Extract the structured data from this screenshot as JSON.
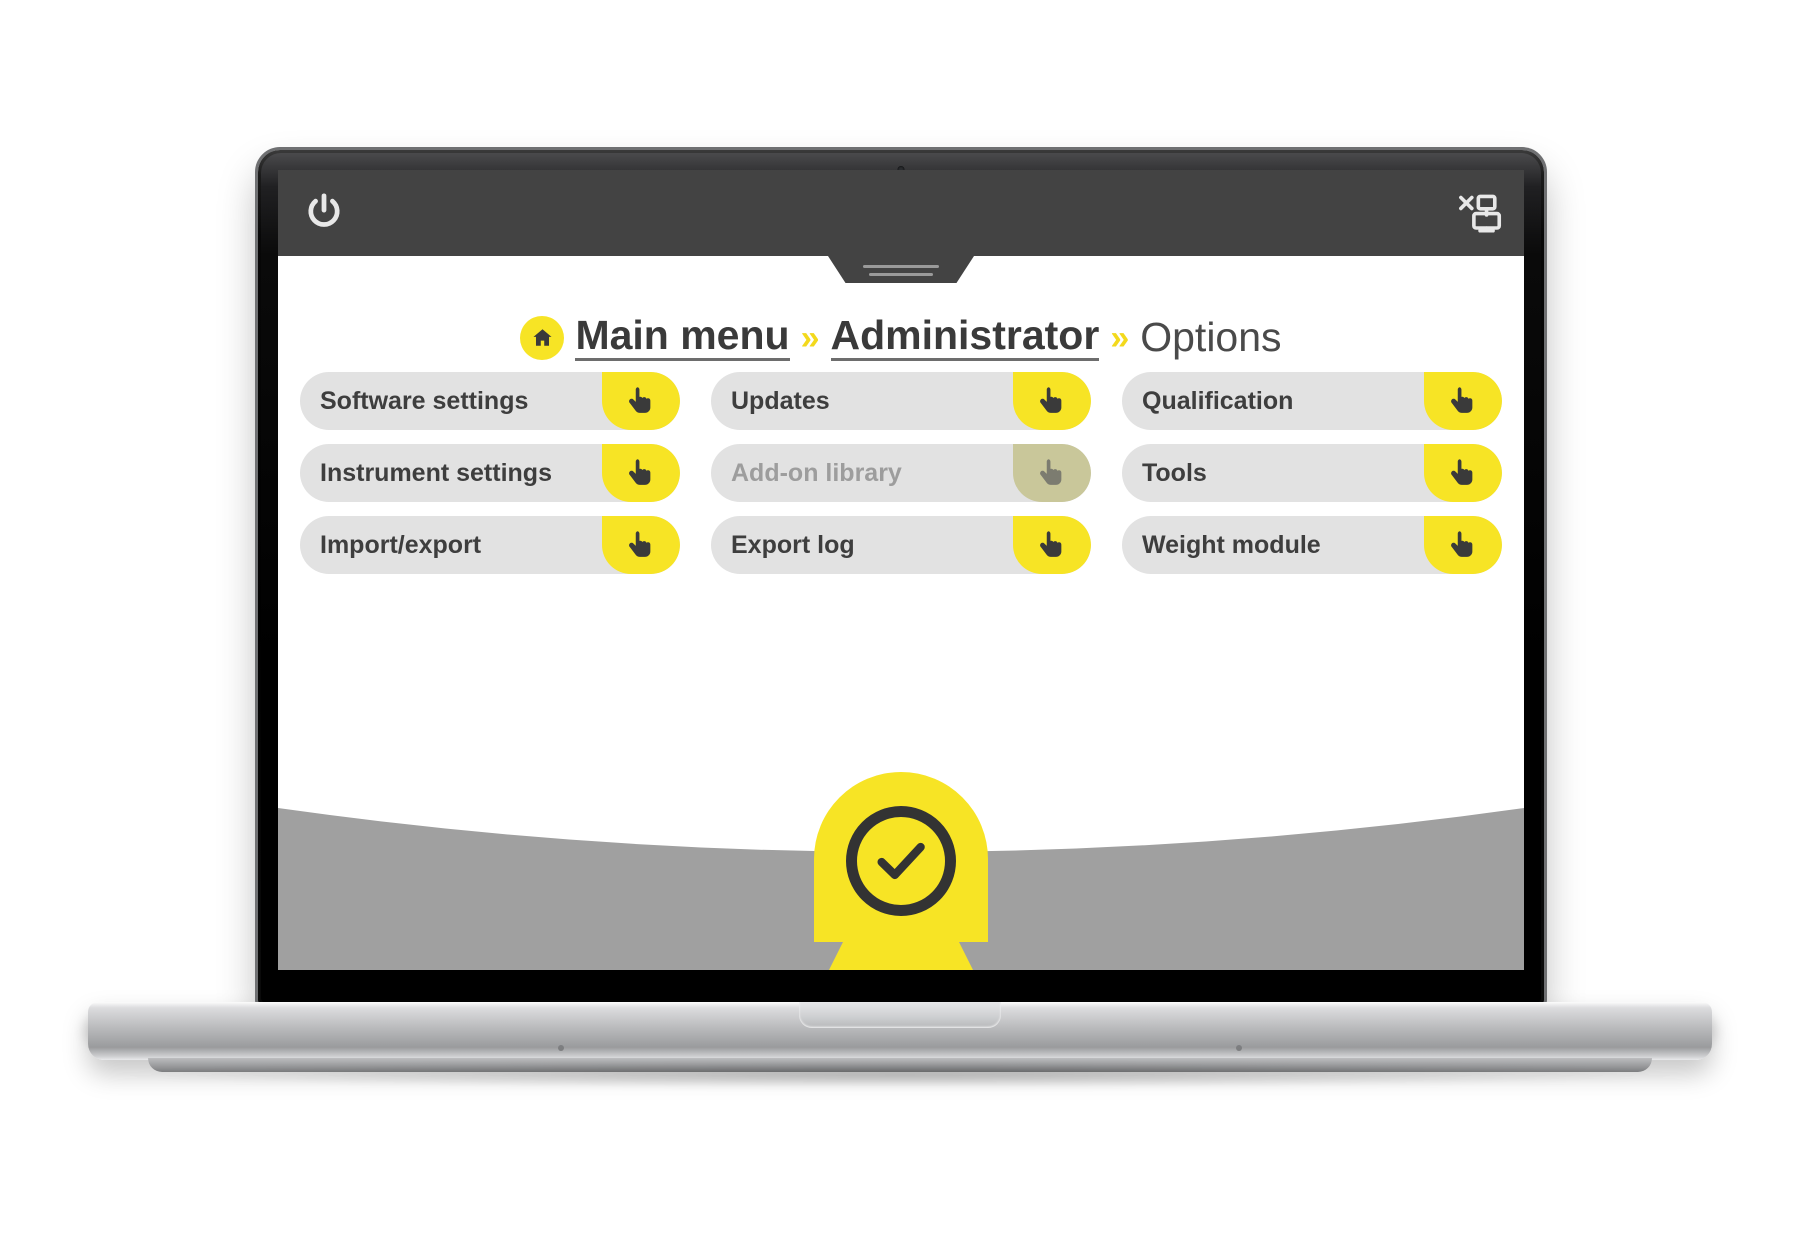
{
  "device": {
    "type": "laptop",
    "camera_label": "webcam"
  },
  "app_header": {
    "power_icon": "power-icon",
    "network_icon": "network-disconnected-icon",
    "tab_handle": "drag-handle"
  },
  "breadcrumb": {
    "home_icon": "home-icon",
    "separator": "»",
    "items": [
      {
        "label": "Main menu",
        "active": false,
        "link": true
      },
      {
        "label": "Administrator",
        "active": false,
        "link": true
      },
      {
        "label": "Options",
        "active": true,
        "link": false
      }
    ]
  },
  "options_menu": {
    "cursor_icon": "pointing-hand-icon",
    "buttons": [
      {
        "label": "Software settings",
        "enabled": true,
        "column": 1,
        "row": 1
      },
      {
        "label": "Updates",
        "enabled": true,
        "column": 2,
        "row": 1
      },
      {
        "label": "Qualification",
        "enabled": true,
        "column": 3,
        "row": 1
      },
      {
        "label": "Instrument settings",
        "enabled": true,
        "column": 1,
        "row": 2
      },
      {
        "label": "Add-on library",
        "enabled": false,
        "column": 2,
        "row": 2
      },
      {
        "label": "Tools",
        "enabled": true,
        "column": 3,
        "row": 2
      },
      {
        "label": "Import/export",
        "enabled": true,
        "column": 1,
        "row": 3
      },
      {
        "label": "Export log",
        "enabled": true,
        "column": 2,
        "row": 3
      },
      {
        "label": "Weight module",
        "enabled": true,
        "column": 3,
        "row": 3
      }
    ]
  },
  "status_badge": {
    "icon": "check-circle-icon",
    "meaning": "confirm"
  },
  "colors": {
    "accent_yellow": "#f7e425",
    "accent_yellow_disabled": "#c9c79a",
    "header_dark": "#434343",
    "button_gray": "#e2e2e2",
    "label_dark": "#3e3e3e",
    "label_disabled": "#9d9d9d",
    "footer_gray": "#a0a0a0",
    "badge_dark": "#333333"
  }
}
